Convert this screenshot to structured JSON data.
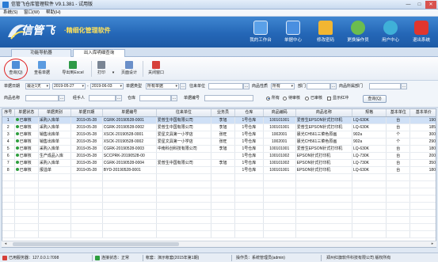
{
  "window": {
    "title": "信管飞仓库管理软件 V9.1.381 - 试用版",
    "controls": [
      "—",
      "□",
      "✕"
    ]
  },
  "menu": [
    "系统(S)",
    "窗口(W)",
    "帮助(H)"
  ],
  "banner": {
    "logo": "信管飞",
    "slogan": "·精细化管理软件",
    "nav": [
      {
        "label": "我的工作台",
        "icon": "workbench-icon",
        "color": "#5aa0e8"
      },
      {
        "label": "单据中心",
        "icon": "document-center-icon",
        "color": "#4a8fe0"
      },
      {
        "label": "修改密码",
        "icon": "lock-icon",
        "color": "#f2b632"
      },
      {
        "label": "更换操作员",
        "icon": "switch-user-icon",
        "color": "#6bbd4f"
      },
      {
        "label": "用户中心",
        "icon": "user-center-icon",
        "color": "#3fb0d8"
      },
      {
        "label": "退出系统",
        "icon": "power-icon",
        "color": "#e0362e"
      }
    ]
  },
  "tabs": [
    {
      "label": "功能导航器",
      "active": false
    },
    {
      "label": "出入库明细查询",
      "active": true
    }
  ],
  "toolbar": {
    "buttons": [
      {
        "label": "查询(Q)",
        "icon": "query-icon",
        "color": "#4f8fd8"
      },
      {
        "label": "查看单据",
        "icon": "view-document-icon",
        "color": "#5b9be0"
      },
      {
        "label": "导出到Excel",
        "icon": "excel-icon",
        "color": "#2f9a47"
      },
      {
        "label": "打印",
        "icon": "print-icon",
        "color": "#7a8594",
        "has_dropdown": true
      },
      {
        "label": "页面设计",
        "icon": "page-design-icon",
        "color": "#6a8fc9"
      },
      {
        "label": "关闭窗口",
        "icon": "close-window-icon",
        "color": "#d6403a"
      }
    ]
  },
  "filters": {
    "date_label": "单据日期",
    "date_range": "最近1天",
    "date_from": "2019-05-27",
    "date_to": "2019-06-03",
    "doc_type_label": "单据类型",
    "doc_type_value": "所有单据",
    "partner_label": "往来单位",
    "partner_value": "",
    "category_label": "商品性质",
    "category_value": "所有",
    "dept_label": "部门",
    "dept_value": "",
    "goods_type_label": "商品所属部门",
    "goods_type_value": "",
    "product_label": "商品名称",
    "product_value": "",
    "handler_label": "经手人",
    "handler_value": "",
    "warehouse_label": "仓库",
    "warehouse_value": "",
    "doc_no_label": "单据编号",
    "doc_no_value": "",
    "status_options": [
      "所有",
      "待审核",
      "已审核"
    ],
    "status_selected": "所有",
    "show_red_label": "显示红冲",
    "show_red_checked": false,
    "query_button": "查询(Q)"
  },
  "table": {
    "columns": [
      "序号",
      "单据状态",
      "单据类别",
      "单据日期",
      "单据编号",
      "往来单位",
      "业务员",
      "仓库",
      "商品编码",
      "商品名称",
      "规格",
      "基本单位",
      "基本单价"
    ],
    "rows": [
      [
        "1",
        "已审核",
        "采购入库单",
        "2019-05-28",
        "CGRK-20190528-0001",
        "爱普生中国有限公司",
        "李旭",
        "1号仓库",
        "100101001",
        "爱普生EPSON针式打印机",
        "LQ-630K",
        "台",
        "190"
      ],
      [
        "2",
        "已审核",
        "采购入库单",
        "2019-05-28",
        "CGRK-20190528-0002",
        "爱普生中国有限公司",
        "李旭",
        "1号仓库",
        "100101001",
        "爱普生EPSON针式打印机",
        "LQ-630K",
        "台",
        "185"
      ],
      [
        "3",
        "已审核",
        "销售出库单",
        "2019-05-28",
        "XSCK-20190528-0001",
        "爱星文具第一小学店",
        "张旺",
        "1号仓库",
        "1002001",
        "晨光CH561三菜色原画",
        "902a",
        "个",
        "300"
      ],
      [
        "4",
        "已审核",
        "销售出库单",
        "2019-05-28",
        "XSCK-20190528-0002",
        "爱星文具第一小学店",
        "张旺",
        "1号仓库",
        "1002001",
        "晨光CH561三菜色原画",
        "902a",
        "个",
        "290"
      ],
      [
        "5",
        "已审核",
        "采购入库单",
        "2019-05-28",
        "CGRK-20190528-0003",
        "中南科创科技有限公司",
        "李旭",
        "1号仓库",
        "100101001",
        "爱普生EPSON针式打印机",
        "LQ-630K",
        "台",
        "180"
      ],
      [
        "6",
        "已审核",
        "生产成品入库",
        "2019-05-28",
        "SCCPRK-20190528-00",
        "",
        "",
        "1号仓库",
        "100101002",
        "EPSON针式打印机",
        "LQ-730K",
        "台",
        "200"
      ],
      [
        "7",
        "已审核",
        "采购入库单",
        "2019-05-28",
        "CGRK-20190528-0004",
        "爱普生中国有限公司",
        "李旭",
        "1号仓库",
        "100101002",
        "EPSON针式打印机",
        "LQ-730K",
        "台",
        "350"
      ],
      [
        "8",
        "已审核",
        "报溢单",
        "2019-05-28",
        "BYD-20190528-0001",
        "",
        "",
        "1号仓库",
        "100101001",
        "EPSON针式打印机",
        "LQ-630K",
        "台",
        "180"
      ]
    ]
  },
  "statusbar": {
    "server": "已用服务器：127.0.0.1:7098",
    "connection": "连接状态：正常",
    "account": "帐套：演示帐套(2015年第1期)",
    "operator": "操作员：系统管理员(admin)",
    "company": "郑州红旗软件科技有限公司 版权所有"
  }
}
